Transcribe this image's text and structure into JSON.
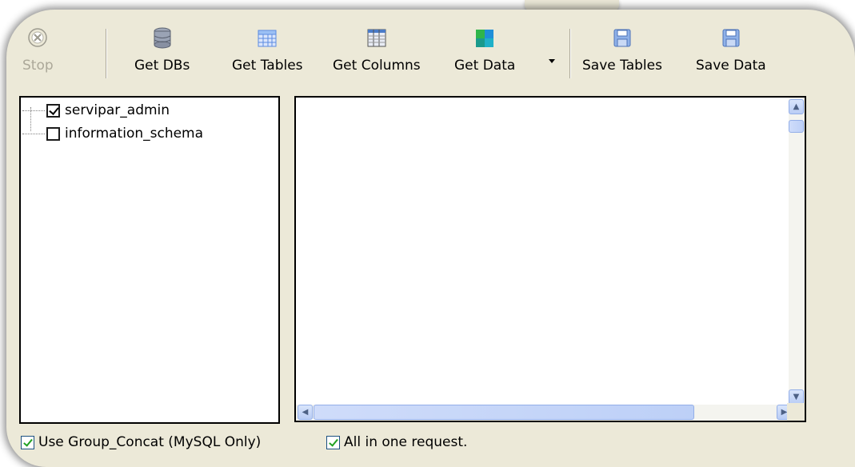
{
  "toolbar": {
    "stop": {
      "label": "Stop",
      "icon": "stop-icon"
    },
    "get_dbs": {
      "label": "Get DBs",
      "icon": "database-icon"
    },
    "get_tables": {
      "label": "Get Tables",
      "icon": "table-grid-icon"
    },
    "get_columns": {
      "label": "Get Columns",
      "icon": "columns-icon"
    },
    "get_data": {
      "label": "Get Data",
      "icon": "data-icon"
    },
    "save_tables": {
      "label": "Save Tables",
      "icon": "floppy-disk-icon"
    },
    "save_data": {
      "label": "Save Data",
      "icon": "floppy-disk-icon"
    }
  },
  "tree": {
    "items": [
      {
        "label": "servipar_admin",
        "checked": true
      },
      {
        "label": "information_schema",
        "checked": false
      }
    ]
  },
  "options": {
    "group_concat": {
      "label": "Use Group_Concat (MySQL Only)",
      "checked": true
    },
    "one_request": {
      "label": "All in one request.",
      "checked": true
    }
  },
  "colors": {
    "window_bg": "#ece9d8",
    "scrollbar_accent": "#b9cdf5",
    "check_green": "#21a121"
  }
}
